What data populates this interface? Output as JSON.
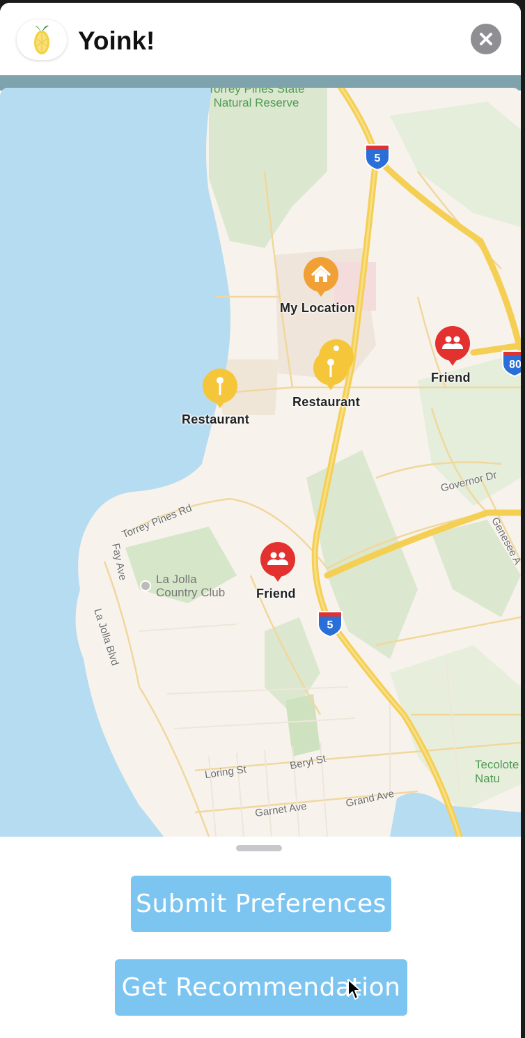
{
  "app": {
    "title": "Yoink!",
    "icon": "lemon-icon",
    "close_icon": "close-icon"
  },
  "map": {
    "markers": [
      {
        "label": "My Location",
        "icon": "home-icon",
        "color": "#f0a034"
      },
      {
        "label": "Restaurant",
        "icon": "restaurant-pin-icon",
        "color": "#f6c63a"
      },
      {
        "label": "Restaurant",
        "icon": "restaurant-pin-icon",
        "color": "#f6c63a"
      },
      {
        "label": "Friend",
        "icon": "people-icon",
        "color": "#e3312f"
      },
      {
        "label": "Friend",
        "icon": "people-icon",
        "color": "#e3312f"
      }
    ],
    "places": {
      "torrey_pines": "Torrey Pines State Natural Reserve",
      "la_jolla_cc": "La Jolla Country Club",
      "tecolote": "Tecolote Natu"
    },
    "streets": {
      "torrey_pines_rd": "Torrey Pines Rd",
      "governor_dr": "Governor Dr",
      "genesee": "Genesee A",
      "fay_ave": "Fay Ave",
      "la_jolla_blvd": "La Jolla Blvd",
      "loring_st": "Loring St",
      "beryl_st": "Beryl St",
      "garnet_ave": "Garnet Ave",
      "grand_ave": "Grand Ave"
    },
    "shields": {
      "i5": "5",
      "i805": "80"
    }
  },
  "actions": {
    "submit_label": "Submit Preferences",
    "recommend_label": "Get Recommendation"
  },
  "colors": {
    "button": "#7dc5f1",
    "water": "#b6dcf2",
    "highway": "#f5cf54"
  }
}
